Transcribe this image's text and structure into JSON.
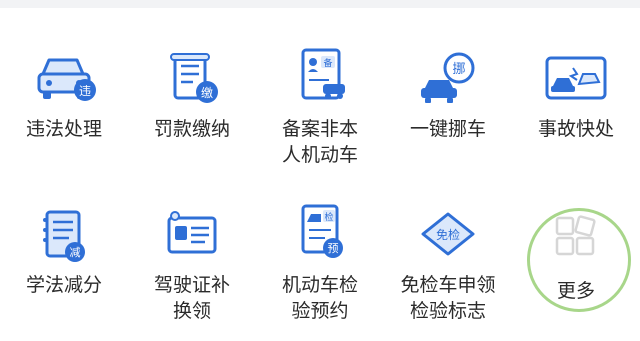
{
  "services": [
    {
      "label": "违法处理",
      "badge": "违",
      "icon": "car-violation-icon"
    },
    {
      "label": "罚款缴纳",
      "badge": "缴",
      "icon": "fine-payment-icon"
    },
    {
      "label": "备案非本\n人机动车",
      "badge": "备",
      "icon": "vehicle-registration-icon"
    },
    {
      "label": "一键挪车",
      "badge": "挪",
      "icon": "move-car-icon"
    },
    {
      "label": "事故快处",
      "badge": "",
      "icon": "accident-icon"
    },
    {
      "label": "学法减分",
      "badge": "减",
      "icon": "study-deduct-icon"
    },
    {
      "label": "驾驶证补\n换领",
      "badge": "",
      "icon": "license-replace-icon"
    },
    {
      "label": "机动车检\n验预约",
      "badge": "检",
      "badge2": "预",
      "icon": "inspection-booking-icon"
    },
    {
      "label": "免检车申领\n检验标志",
      "badge": "免检",
      "icon": "exempt-inspection-icon"
    },
    {
      "label": "更多",
      "badge": "",
      "icon": "more-grid-icon"
    }
  ],
  "colors": {
    "primary": "#2f6fd6",
    "light": "#dbe8fb",
    "highlight_ring": "#a8d68a",
    "text": "#2b2b2b"
  }
}
